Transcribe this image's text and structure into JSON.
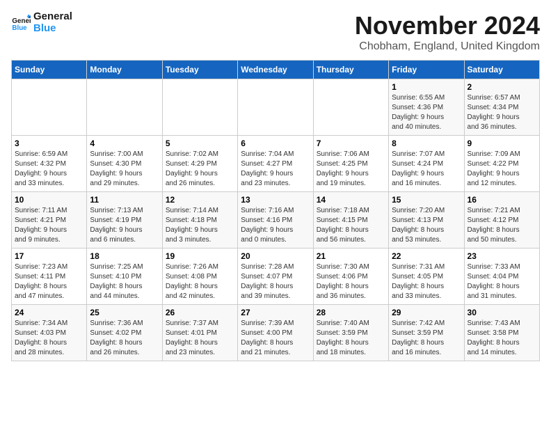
{
  "logo": {
    "line1": "General",
    "line2": "Blue"
  },
  "title": "November 2024",
  "subtitle": "Chobham, England, United Kingdom",
  "headers": [
    "Sunday",
    "Monday",
    "Tuesday",
    "Wednesday",
    "Thursday",
    "Friday",
    "Saturday"
  ],
  "weeks": [
    [
      {
        "day": "",
        "info": ""
      },
      {
        "day": "",
        "info": ""
      },
      {
        "day": "",
        "info": ""
      },
      {
        "day": "",
        "info": ""
      },
      {
        "day": "",
        "info": ""
      },
      {
        "day": "1",
        "info": "Sunrise: 6:55 AM\nSunset: 4:36 PM\nDaylight: 9 hours\nand 40 minutes."
      },
      {
        "day": "2",
        "info": "Sunrise: 6:57 AM\nSunset: 4:34 PM\nDaylight: 9 hours\nand 36 minutes."
      }
    ],
    [
      {
        "day": "3",
        "info": "Sunrise: 6:59 AM\nSunset: 4:32 PM\nDaylight: 9 hours\nand 33 minutes."
      },
      {
        "day": "4",
        "info": "Sunrise: 7:00 AM\nSunset: 4:30 PM\nDaylight: 9 hours\nand 29 minutes."
      },
      {
        "day": "5",
        "info": "Sunrise: 7:02 AM\nSunset: 4:29 PM\nDaylight: 9 hours\nand 26 minutes."
      },
      {
        "day": "6",
        "info": "Sunrise: 7:04 AM\nSunset: 4:27 PM\nDaylight: 9 hours\nand 23 minutes."
      },
      {
        "day": "7",
        "info": "Sunrise: 7:06 AM\nSunset: 4:25 PM\nDaylight: 9 hours\nand 19 minutes."
      },
      {
        "day": "8",
        "info": "Sunrise: 7:07 AM\nSunset: 4:24 PM\nDaylight: 9 hours\nand 16 minutes."
      },
      {
        "day": "9",
        "info": "Sunrise: 7:09 AM\nSunset: 4:22 PM\nDaylight: 9 hours\nand 12 minutes."
      }
    ],
    [
      {
        "day": "10",
        "info": "Sunrise: 7:11 AM\nSunset: 4:21 PM\nDaylight: 9 hours\nand 9 minutes."
      },
      {
        "day": "11",
        "info": "Sunrise: 7:13 AM\nSunset: 4:19 PM\nDaylight: 9 hours\nand 6 minutes."
      },
      {
        "day": "12",
        "info": "Sunrise: 7:14 AM\nSunset: 4:18 PM\nDaylight: 9 hours\nand 3 minutes."
      },
      {
        "day": "13",
        "info": "Sunrise: 7:16 AM\nSunset: 4:16 PM\nDaylight: 9 hours\nand 0 minutes."
      },
      {
        "day": "14",
        "info": "Sunrise: 7:18 AM\nSunset: 4:15 PM\nDaylight: 8 hours\nand 56 minutes."
      },
      {
        "day": "15",
        "info": "Sunrise: 7:20 AM\nSunset: 4:13 PM\nDaylight: 8 hours\nand 53 minutes."
      },
      {
        "day": "16",
        "info": "Sunrise: 7:21 AM\nSunset: 4:12 PM\nDaylight: 8 hours\nand 50 minutes."
      }
    ],
    [
      {
        "day": "17",
        "info": "Sunrise: 7:23 AM\nSunset: 4:11 PM\nDaylight: 8 hours\nand 47 minutes."
      },
      {
        "day": "18",
        "info": "Sunrise: 7:25 AM\nSunset: 4:10 PM\nDaylight: 8 hours\nand 44 minutes."
      },
      {
        "day": "19",
        "info": "Sunrise: 7:26 AM\nSunset: 4:08 PM\nDaylight: 8 hours\nand 42 minutes."
      },
      {
        "day": "20",
        "info": "Sunrise: 7:28 AM\nSunset: 4:07 PM\nDaylight: 8 hours\nand 39 minutes."
      },
      {
        "day": "21",
        "info": "Sunrise: 7:30 AM\nSunset: 4:06 PM\nDaylight: 8 hours\nand 36 minutes."
      },
      {
        "day": "22",
        "info": "Sunrise: 7:31 AM\nSunset: 4:05 PM\nDaylight: 8 hours\nand 33 minutes."
      },
      {
        "day": "23",
        "info": "Sunrise: 7:33 AM\nSunset: 4:04 PM\nDaylight: 8 hours\nand 31 minutes."
      }
    ],
    [
      {
        "day": "24",
        "info": "Sunrise: 7:34 AM\nSunset: 4:03 PM\nDaylight: 8 hours\nand 28 minutes."
      },
      {
        "day": "25",
        "info": "Sunrise: 7:36 AM\nSunset: 4:02 PM\nDaylight: 8 hours\nand 26 minutes."
      },
      {
        "day": "26",
        "info": "Sunrise: 7:37 AM\nSunset: 4:01 PM\nDaylight: 8 hours\nand 23 minutes."
      },
      {
        "day": "27",
        "info": "Sunrise: 7:39 AM\nSunset: 4:00 PM\nDaylight: 8 hours\nand 21 minutes."
      },
      {
        "day": "28",
        "info": "Sunrise: 7:40 AM\nSunset: 3:59 PM\nDaylight: 8 hours\nand 18 minutes."
      },
      {
        "day": "29",
        "info": "Sunrise: 7:42 AM\nSunset: 3:59 PM\nDaylight: 8 hours\nand 16 minutes."
      },
      {
        "day": "30",
        "info": "Sunrise: 7:43 AM\nSunset: 3:58 PM\nDaylight: 8 hours\nand 14 minutes."
      }
    ]
  ]
}
